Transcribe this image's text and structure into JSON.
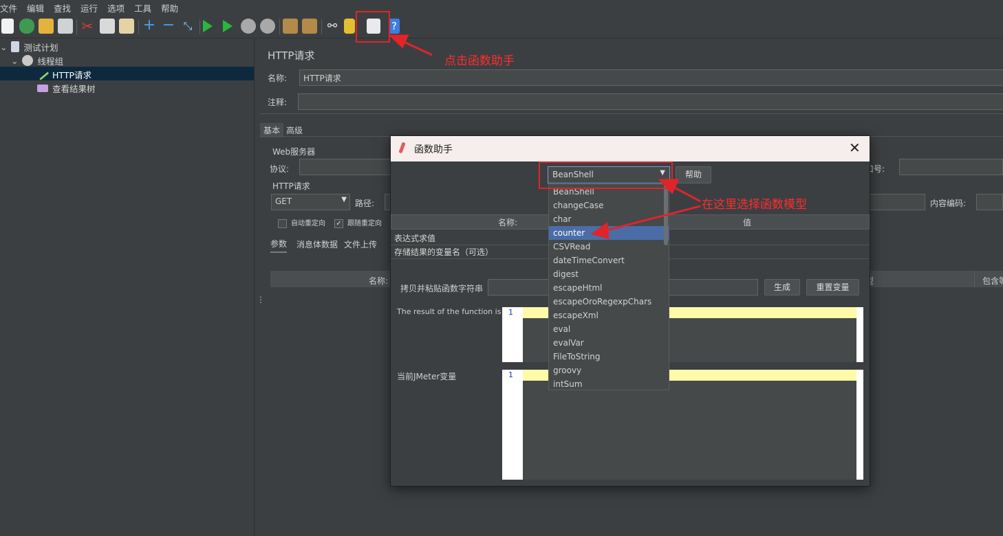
{
  "menubar": [
    "文件",
    "编辑",
    "查找",
    "运行",
    "选项",
    "工具",
    "帮助"
  ],
  "tree": {
    "test_plan": "测试计划",
    "thread_group": "线程组",
    "http_request": "HTTP请求",
    "result_tree": "查看结果树"
  },
  "panel": {
    "title": "HTTP请求",
    "name_label": "名称:",
    "name_value": "HTTP请求",
    "comment_label": "注释:",
    "tab_basic": "基本",
    "tab_advanced": "高级",
    "web_server": "Web服务器",
    "protocol_label": "协议:",
    "port_label": "口号:",
    "http_request_group": "HTTP请求",
    "method": "GET",
    "path_label": "路径:",
    "encoding_label": "内容编码:",
    "auto_redirect": "自动重定向",
    "follow_redirect": "跟随重定向",
    "tab_params": "参数",
    "tab_body": "消息体数据",
    "tab_files": "文件上传",
    "col_name": "名称:",
    "col_type": "型",
    "col_include": "包含等"
  },
  "dialog": {
    "title": "函数助手",
    "selected_function": "BeanShell",
    "help_button": "帮助",
    "col_name": "名称:",
    "col_value": "值",
    "rows": [
      "表达式求值",
      "存储结果的变量名（可选）"
    ],
    "copy_paste_label": "拷贝并粘贴函数字符串",
    "generate_button": "生成",
    "reset_button": "重置变量",
    "result_label": "The result of the function is",
    "jmeter_vars_label": "当前JMeter变量",
    "line_number": "1"
  },
  "dropdown": {
    "items": [
      "BeanShell",
      "changeCase",
      "char",
      "counter",
      "CSVRead",
      "dateTimeConvert",
      "digest",
      "escapeHtml",
      "escapeOroRegexpChars",
      "escapeXml",
      "eval",
      "evalVar",
      "FileToString",
      "groovy",
      "intSum"
    ],
    "selected": "counter"
  },
  "annotations": {
    "click_helper": "点击函数助手",
    "choose_model": "在这里选择函数模型"
  },
  "colors": {
    "background": "#3c3f41",
    "selection": "#4a6da7",
    "annotation_red": "#e0242a"
  }
}
